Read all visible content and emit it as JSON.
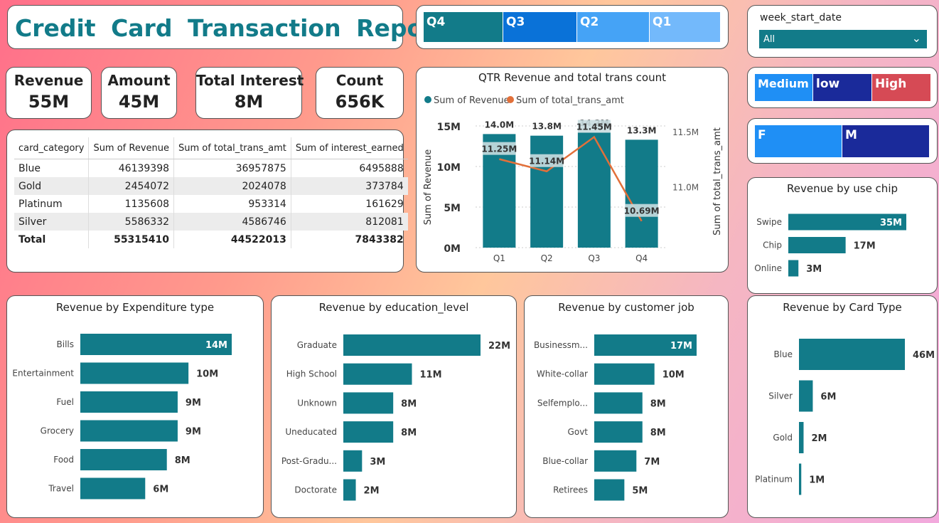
{
  "report_title": "Credit  Card  Transaction  Report",
  "colors": {
    "teal": "#127b89",
    "orange": "#e2703a",
    "blue": "#1f8ff5",
    "navy": "#1a2a9a",
    "red": "#d64a55"
  },
  "quarter_slicer": [
    {
      "label": "Q4",
      "color": "#127b89"
    },
    {
      "label": "Q3",
      "color": "#0a72d8"
    },
    {
      "label": "Q2",
      "color": "#45a3f6"
    },
    {
      "label": "Q1",
      "color": "#73b9fb"
    }
  ],
  "week_filter": {
    "label": "week_start_date",
    "value": "All"
  },
  "income_slicer": [
    {
      "label": "Medium",
      "color": "#1f8ff5"
    },
    {
      "label": "low",
      "color": "#1a2a9a"
    },
    {
      "label": "High",
      "color": "#d64a55"
    }
  ],
  "gender_slicer": [
    {
      "label": "F",
      "color": "#1f8ff5"
    },
    {
      "label": "M",
      "color": "#1a2a9a"
    }
  ],
  "kpis": [
    {
      "label": "Revenue",
      "value": "55M"
    },
    {
      "label": "Amount",
      "value": "45M"
    },
    {
      "label": "Total Interest",
      "value": "8M"
    },
    {
      "label": "Count",
      "value": "656K"
    }
  ],
  "summary_table": {
    "headers": [
      "card_category",
      "Sum of Revenue",
      "Sum of total_trans_amt",
      "Sum of interest_earned"
    ],
    "rows": [
      [
        "Blue",
        "46139398",
        "36957875",
        "6495888"
      ],
      [
        "Gold",
        "2454072",
        "2024078",
        "373784"
      ],
      [
        "Platinum",
        "1135608",
        "953314",
        "161629"
      ],
      [
        "Silver",
        "5586332",
        "4586746",
        "812081"
      ]
    ],
    "total": [
      "Total",
      "55315410",
      "44522013",
      "7843382"
    ]
  },
  "chart_data": [
    {
      "type": "bar+line",
      "title": "QTR Revenue and total trans count",
      "categories": [
        "Q1",
        "Q2",
        "Q3",
        "Q4"
      ],
      "series": [
        {
          "name": "Sum of Revenue",
          "values": [
            14.0,
            13.8,
            14.2,
            13.3
          ],
          "value_labels": [
            "14.0M",
            "13.8M",
            "14.2M",
            "13.3M"
          ]
        },
        {
          "name": "Sum of total_trans_amt",
          "values": [
            11.25,
            11.14,
            11.45,
            10.69
          ],
          "value_labels": [
            "11.25M",
            "11.14M",
            "11.45M",
            "10.69M"
          ]
        }
      ],
      "ylabel": "Sum of Revenue",
      "y2label": "Sum of total_trans_amt",
      "ylim": [
        0,
        15
      ],
      "yticks": [
        "0M",
        "5M",
        "10M",
        "15M"
      ],
      "y2lim": [
        10.45,
        11.55
      ],
      "y2ticks": [
        "11.0M",
        "11.5M"
      ],
      "legend_position": "top-left"
    },
    {
      "type": "bar",
      "title": "Revenue by use chip",
      "categories": [
        "Swipe",
        "Chip",
        "Online"
      ],
      "values": [
        35,
        17,
        3
      ],
      "value_labels": [
        "35M",
        "17M",
        "3M"
      ],
      "xlim": [
        0,
        35
      ]
    },
    {
      "type": "bar",
      "title": "Revenue by Expenditure type",
      "categories": [
        "Bills",
        "Entertainment",
        "Fuel",
        "Grocery",
        "Food",
        "Travel"
      ],
      "values": [
        14,
        10,
        9,
        9,
        8,
        6
      ],
      "value_labels": [
        "14M",
        "10M",
        "9M",
        "9M",
        "8M",
        "6M"
      ],
      "xlim": [
        0,
        14
      ]
    },
    {
      "type": "bar",
      "title": "Revenue by education_level",
      "categories": [
        "Graduate",
        "High School",
        "Unknown",
        "Uneducated",
        "Post-Gradu...",
        "Doctorate"
      ],
      "values": [
        22,
        11,
        8,
        8,
        3,
        2
      ],
      "value_labels": [
        "22M",
        "11M",
        "8M",
        "8M",
        "3M",
        "2M"
      ],
      "xlim": [
        0,
        22
      ]
    },
    {
      "type": "bar",
      "title": "Revenue by customer job",
      "categories": [
        "Businessm...",
        "White-collar",
        "Selfemplo...",
        "Govt",
        "Blue-collar",
        "Retirees"
      ],
      "values": [
        17,
        10,
        8,
        8,
        7,
        5
      ],
      "value_labels": [
        "17M",
        "10M",
        "8M",
        "8M",
        "7M",
        "5M"
      ],
      "xlim": [
        0,
        17
      ]
    },
    {
      "type": "bar",
      "title": "Revenue by Card Type",
      "categories": [
        "Blue",
        "Silver",
        "Gold",
        "Platinum"
      ],
      "values": [
        46,
        6,
        2,
        1
      ],
      "value_labels": [
        "46M",
        "6M",
        "2M",
        "1M"
      ],
      "xlim": [
        0,
        46
      ]
    }
  ]
}
